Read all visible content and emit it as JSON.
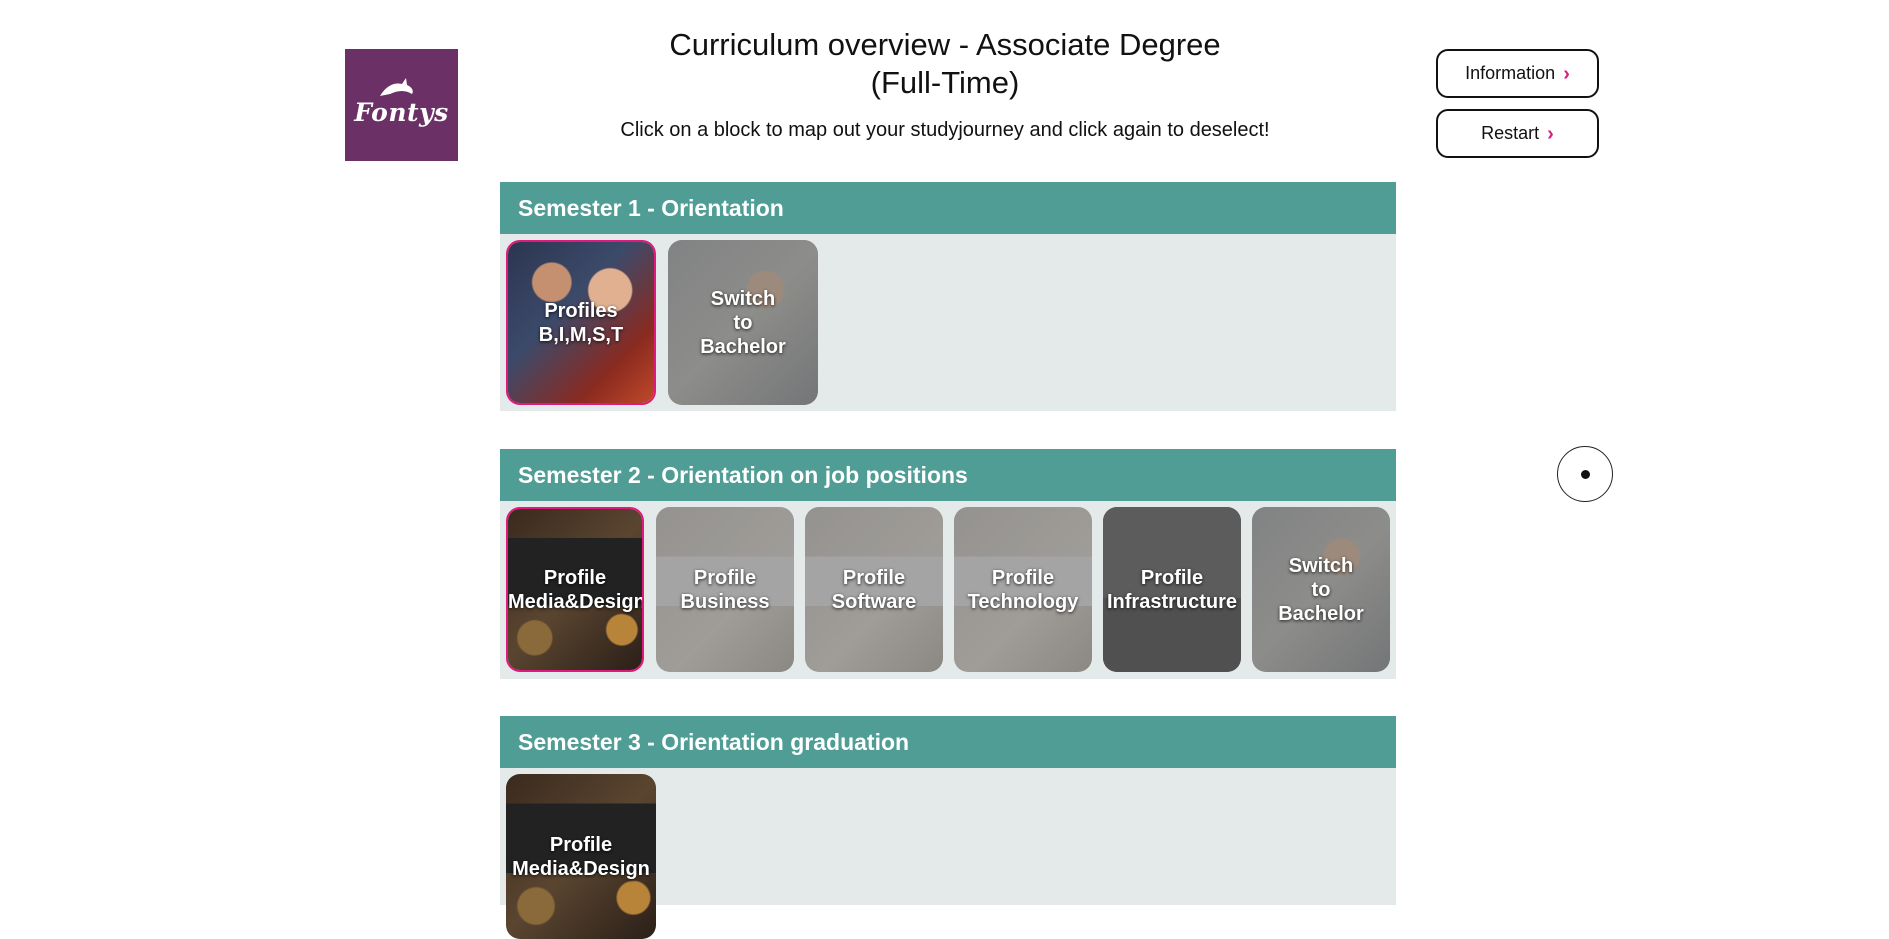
{
  "header": {
    "logo_text": "Fontys",
    "title_line1": "Curriculum overview - Associate Degree",
    "title_line2": "(Full-Time)",
    "subtitle": "Click on a block to map out your studyjourney and click again to deselect!"
  },
  "nav": {
    "information_label": "Information",
    "restart_label": "Restart",
    "chevron": "›"
  },
  "colors": {
    "brand_purple": "#6b3166",
    "header_teal": "#4f9d95",
    "section_bg": "#e4eaea",
    "selected_border": "#e0197d"
  },
  "semesters": [
    {
      "title": "Semester 1 - Orientation",
      "cards": [
        {
          "label": "Profiles\nB,I,M,S,T",
          "selected": true,
          "image": "people-meeting"
        },
        {
          "label": "Switch\nto\nBachelor",
          "selected": false,
          "image": "office-people"
        }
      ]
    },
    {
      "title": "Semester 2 - Orientation on job positions",
      "cards": [
        {
          "label": "Profile\nMedia&Design",
          "selected": true,
          "image": "laptop-desk"
        },
        {
          "label": "Profile\nBusiness",
          "selected": false,
          "image": "desk-calculator"
        },
        {
          "label": "Profile\nSoftware",
          "selected": false,
          "image": "desk-notebook"
        },
        {
          "label": "Profile\nTechnology",
          "selected": false,
          "image": "desk-laptop"
        },
        {
          "label": "Profile\nInfrastructure",
          "selected": false,
          "image": "keyboard"
        },
        {
          "label": "Switch\nto\nBachelor",
          "selected": false,
          "image": "office-people"
        }
      ]
    },
    {
      "title": "Semester 3 - Orientation graduation",
      "cards": [
        {
          "label": "Profile\nMedia&Design",
          "selected": false,
          "image": "laptop-desk"
        }
      ]
    }
  ]
}
